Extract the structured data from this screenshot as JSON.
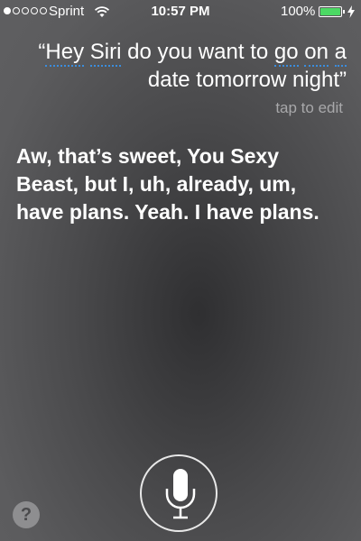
{
  "status_bar": {
    "carrier": "Sprint",
    "time": "10:57 PM",
    "battery_percent": "100%",
    "signal_bars_filled": 1,
    "signal_bars_total": 5,
    "battery_color": "#4cd964",
    "icons": [
      "wifi-icon",
      "battery-icon",
      "charging-bolt-icon"
    ]
  },
  "query": {
    "open_quote": "“",
    "word1": "Hey",
    "word2": "Siri",
    "middle": " do you want to ",
    "word3": "go",
    "word4": "on",
    "word5": "a",
    "line2": "date tomorrow night",
    "close_quote": "”"
  },
  "tap_to_edit": "tap to edit",
  "response": "Aw, that’s sweet, You Sexy Beast, but I, uh, already, um, have plans. Yeah. I have plans.",
  "help_button": {
    "label": "?"
  },
  "mic_button": {
    "icon": "microphone-icon"
  },
  "colors": {
    "background": "#4a4a4c",
    "underline": "#3a8dde",
    "secondary_text": "#a8a8aa"
  }
}
